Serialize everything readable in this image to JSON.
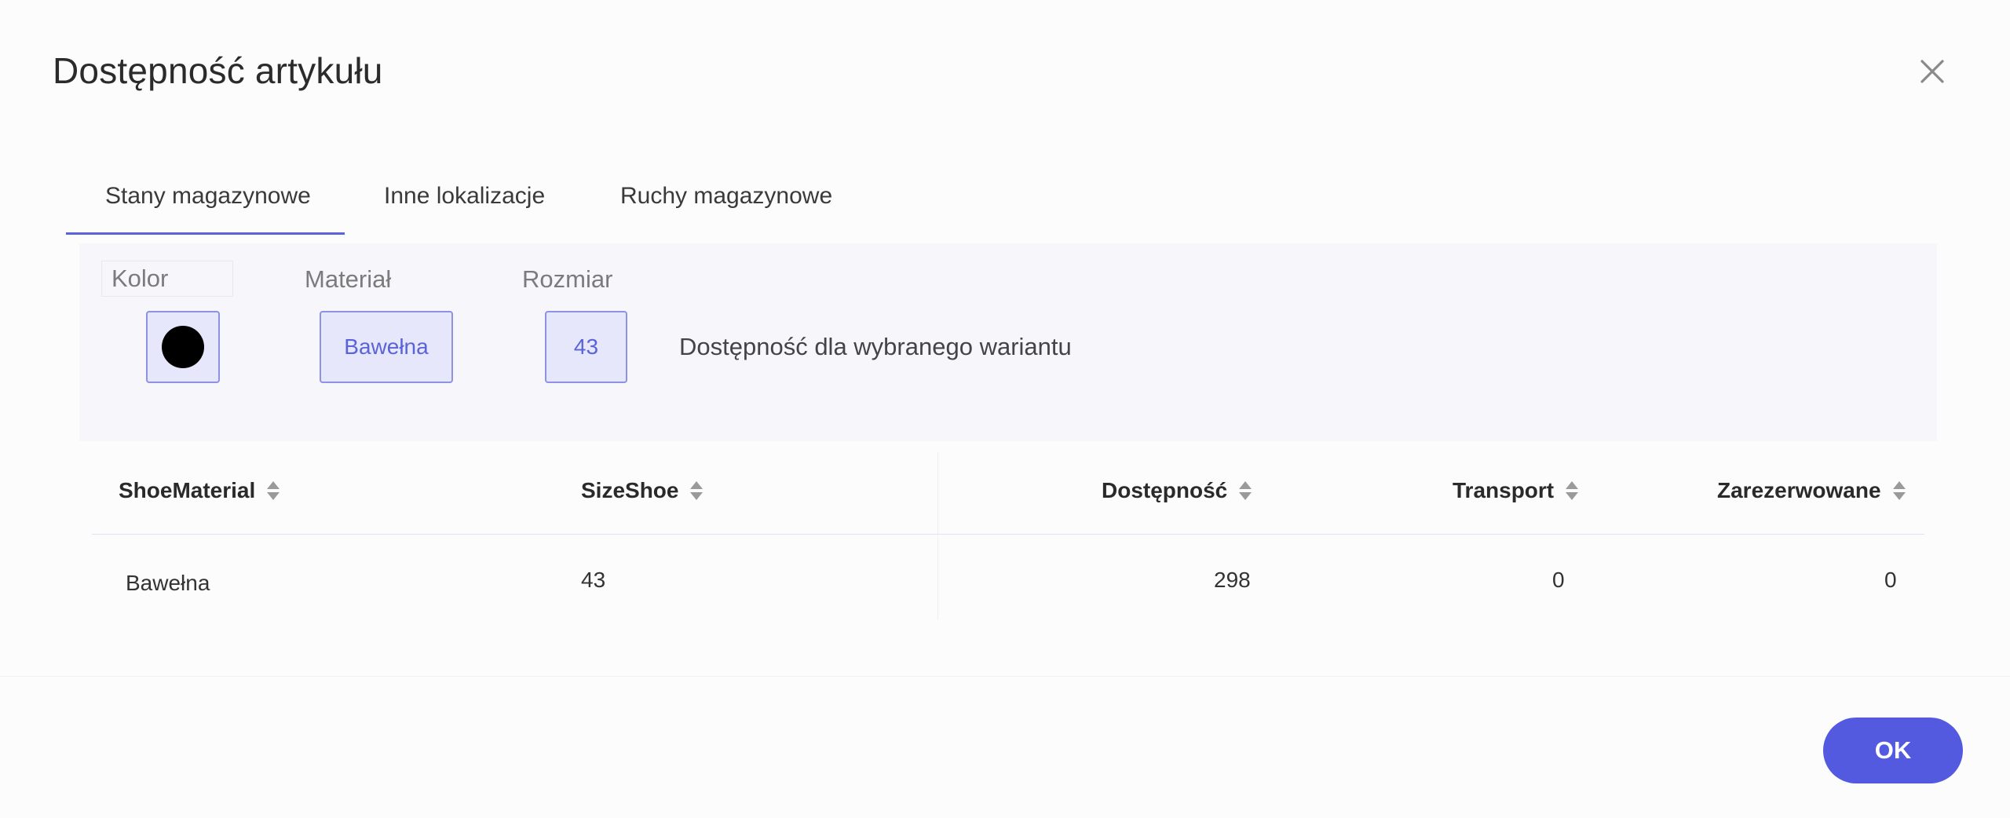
{
  "dialog": {
    "title": "Dostępność artykułu",
    "close_icon": "close-icon"
  },
  "tabs": [
    {
      "label": "Stany magazynowe",
      "active": true
    },
    {
      "label": "Inne lokalizacje",
      "active": false
    },
    {
      "label": "Ruchy magazynowe",
      "active": false
    }
  ],
  "variant": {
    "color_label": "Kolor",
    "color_value": "#000000",
    "material_label": "Materiał",
    "material_value": "Bawełna",
    "size_label": "Rozmiar",
    "size_value": "43",
    "note": "Dostępność dla wybranego wariantu"
  },
  "table": {
    "headers": [
      "ShoeMaterial",
      "SizeShoe",
      "Dostępność",
      "Transport",
      "Zarezerwowane"
    ],
    "rows": [
      [
        "Bawełna",
        "43",
        "298",
        "0",
        "0"
      ]
    ]
  },
  "footer": {
    "ok_label": "OK"
  },
  "colors": {
    "accent": "#535ae0",
    "tab_underline": "#5b63d9",
    "variant_box_bg": "#e6e7fa",
    "variant_box_border": "#8d92e6"
  }
}
